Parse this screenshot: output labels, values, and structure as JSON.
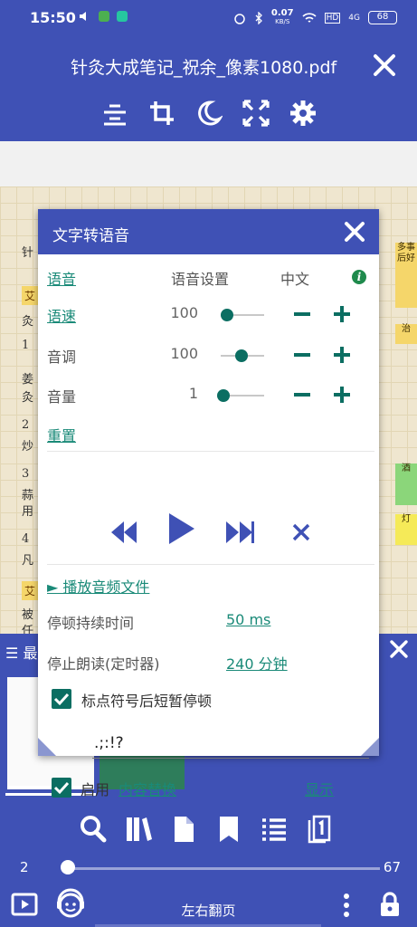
{
  "status_bar": {
    "time": "15:50",
    "net_speed": "0.07",
    "net_unit": "KB/S",
    "signal": "4G",
    "battery": "68"
  },
  "header": {
    "title": "针灸大成笔记_祝余_像素1080.pdf"
  },
  "document": {
    "visible_chars": [
      "针",
      "艾",
      "灸",
      "1",
      "姜",
      "灸",
      "2",
      "炒",
      "3",
      "蒜",
      "用",
      "4",
      "凡",
      "艾",
      "被",
      "任"
    ],
    "side_notes": [
      "多事后好",
      "治",
      "酒",
      "灯"
    ]
  },
  "tts_dialog": {
    "title": "文字转语音",
    "voice_label": "语音",
    "voice_settings_label": "语音设置",
    "language": "中文",
    "speed_label": "语速",
    "speed_value": "100",
    "pitch_label": "音调",
    "pitch_value": "100",
    "volume_label": "音量",
    "volume_value": "1",
    "reset_label": "重置",
    "play_audio_label": "► 播放音频文件",
    "pause_duration_label": "停顿持续时间",
    "pause_duration_value": "50 ms",
    "stop_timer_label": "停止朗读(定时器)",
    "stop_timer_value": "240 分钟",
    "punct_pause_label": "标点符号后短暂停顿",
    "punct_chars": ".;:!?",
    "enable_label": "启用",
    "content_replace_label": "内容替换",
    "show_label": "显示"
  },
  "bottom_panel": {
    "recent_label": "最",
    "page_start": "2",
    "page_end": "67",
    "page_turn_label": "左右翻页"
  },
  "colors": {
    "primary": "#3f51b5",
    "accent": "#0b6e62",
    "link": "#1a8a78"
  }
}
